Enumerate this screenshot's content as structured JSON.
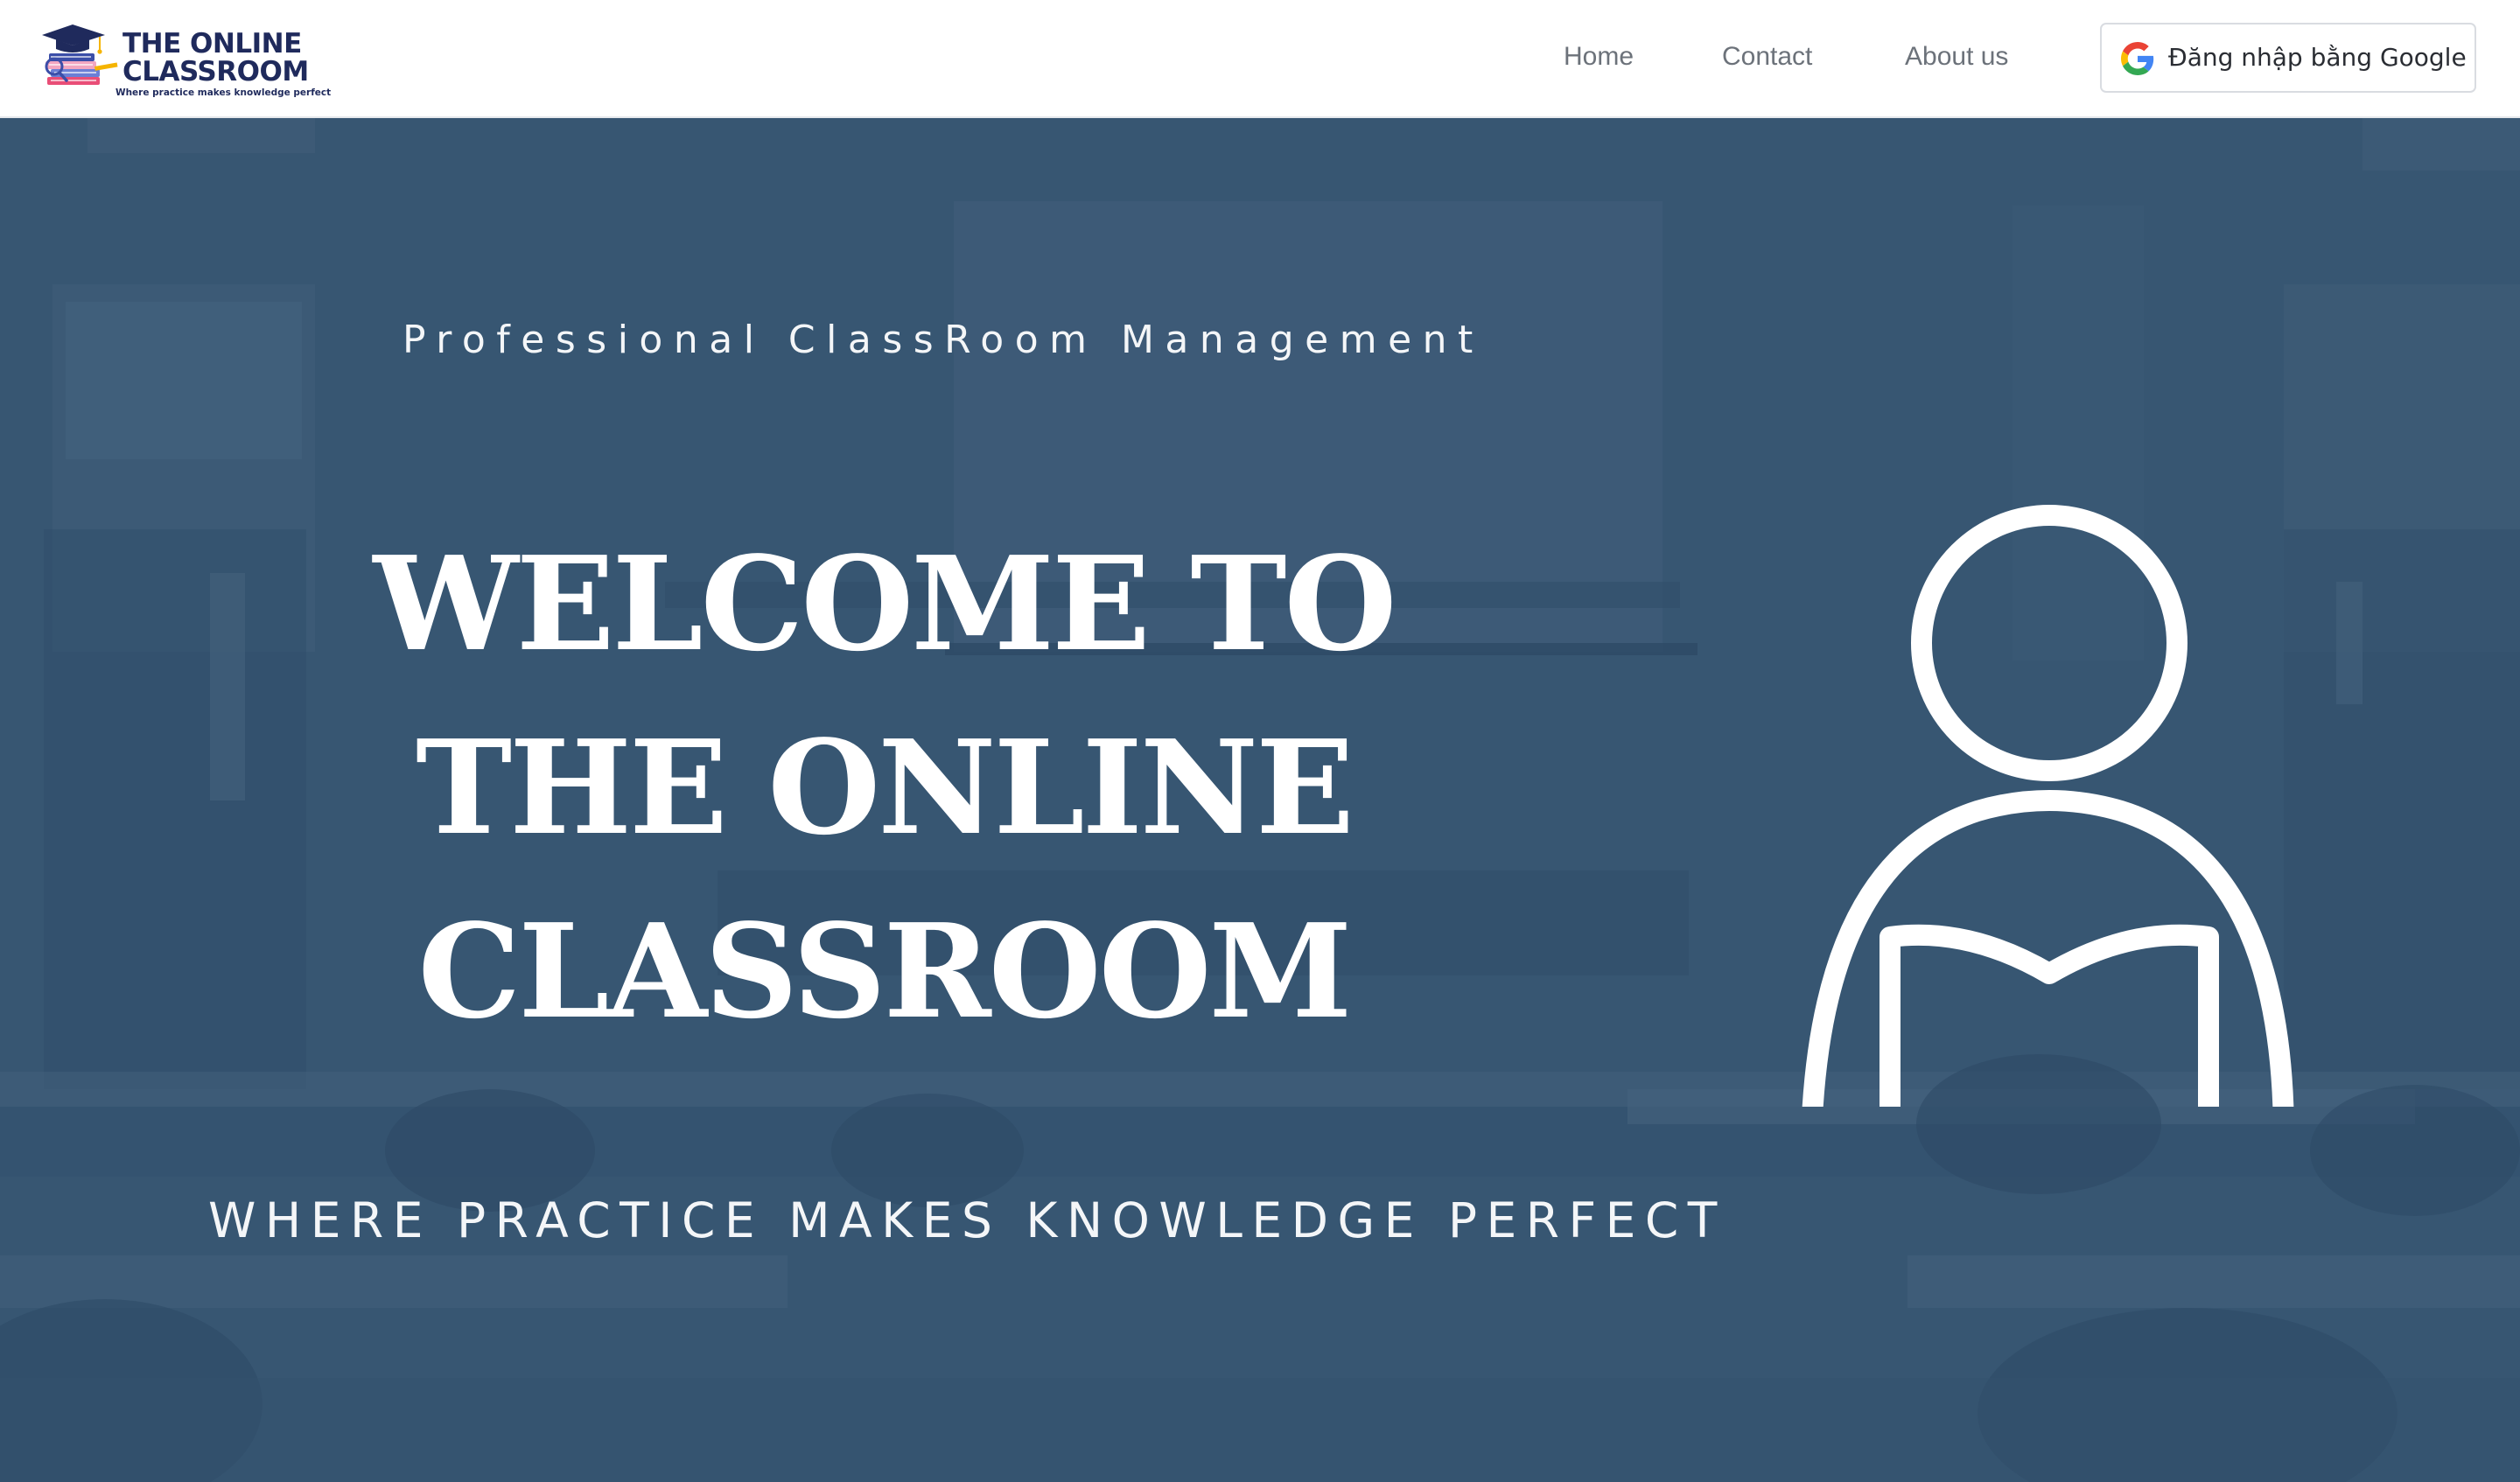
{
  "navbar": {
    "logo": {
      "title_line1": "THE ONLINE",
      "title_line2": "CLASSROOM",
      "tagline": "Where practice makes knowledge perfect"
    },
    "links": [
      {
        "label": "Home"
      },
      {
        "label": "Contact"
      },
      {
        "label": "About us"
      }
    ],
    "login_button": {
      "label": "Đăng nhập bằng Google",
      "icon": "google-icon"
    }
  },
  "hero": {
    "kicker": "Professional ClassRoom Management",
    "headline_lines": [
      "WELCOME TO",
      "THE ONLINE",
      "CLASSROOM"
    ],
    "tagline": "WHERE PRACTICE MAKES KNOWLEDGE PERFECT",
    "illustration": "person-reading-book-icon",
    "background": "classroom-photo"
  },
  "colors": {
    "overlay": "#34536f",
    "nav_text": "#6c727a",
    "logo_navy": "#1f2a5c",
    "hero_text": "#ffffff"
  }
}
